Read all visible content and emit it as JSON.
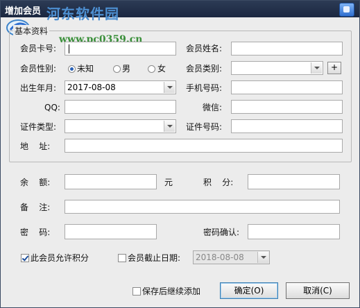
{
  "window": {
    "title": "增加会员"
  },
  "watermark": {
    "text": "河东软件园",
    "url": "www.pc0359.cn"
  },
  "basic": {
    "legend": "基本资料",
    "card_no_label": "会员卡号:",
    "card_no_value": "",
    "name_label": "会员姓名:",
    "name_value": "",
    "gender_label": "会员性别:",
    "gender_options": [
      "未知",
      "男",
      "女"
    ],
    "gender_selected": "未知",
    "type_label": "会员类别:",
    "type_value": "",
    "type_add_label": "+",
    "birthday_label": "出生年月:",
    "birthday_value": "2017-08-08",
    "phone_label": "手机号码:",
    "phone_value": "",
    "qq_label": "QQ:",
    "qq_value": "",
    "wechat_label": "微信:",
    "wechat_value": "",
    "id_type_label": "证件类型:",
    "id_type_value": "",
    "id_no_label": "证件号码:",
    "id_no_value": "",
    "address_label": "地    址:",
    "address_value": ""
  },
  "account": {
    "balance_label": "余    额:",
    "balance_value": "",
    "balance_unit": "元",
    "points_label": "积    分:",
    "points_value": "",
    "note_label": "备    注:",
    "note_value": "",
    "password_label": "密    码:",
    "password_value": "",
    "password_confirm_label": "密码确认:",
    "password_confirm_value": ""
  },
  "options": {
    "allow_points_label": "此会员允许积分",
    "allow_points_checked": true,
    "expiry_label": "会员截止日期:",
    "expiry_checked": false,
    "expiry_value": "2018-08-08"
  },
  "footer": {
    "continue_label": "保存后继续添加",
    "continue_checked": false,
    "ok_label": "确定(O)",
    "cancel_label": "取消(C)"
  }
}
